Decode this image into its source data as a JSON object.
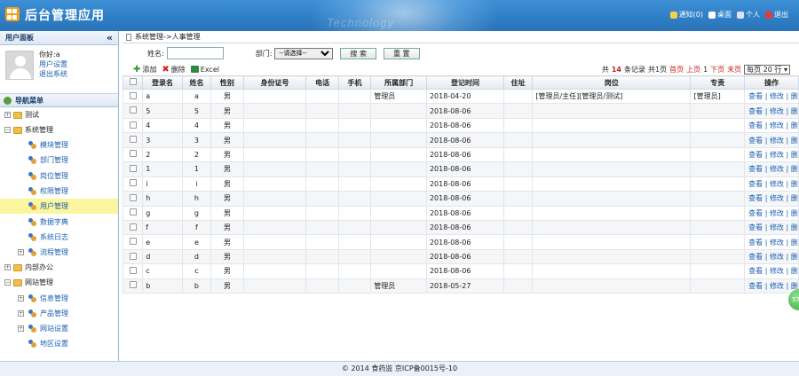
{
  "header": {
    "title": "后台管理应用",
    "watermark": "Technology",
    "links": [
      {
        "label": "通知(0)",
        "icon": "message-icon",
        "color": "#f6d04a"
      },
      {
        "label": "桌面",
        "icon": "home-icon",
        "color": "#ffffff"
      },
      {
        "label": "个人",
        "icon": "user-icon",
        "color": "#e0e0ff"
      },
      {
        "label": "退出",
        "icon": "power-icon",
        "color": "#e23b3b"
      }
    ]
  },
  "sidebar": {
    "panel_title": "用户面板",
    "collapse_glyph": "«",
    "greeting": "你好:a",
    "user_settings": "用户设置",
    "logout": "退出系统",
    "nav_title": "导航菜单",
    "tree": [
      {
        "label": "测试",
        "open": false,
        "children": []
      },
      {
        "label": "系统管理",
        "open": true,
        "children": [
          {
            "label": "模块管理"
          },
          {
            "label": "部门管理"
          },
          {
            "label": "岗位管理"
          },
          {
            "label": "权限管理"
          },
          {
            "label": "用户管理",
            "active": true
          },
          {
            "label": "数据字典"
          },
          {
            "label": "系统日志"
          },
          {
            "label": "流程管理",
            "expandable": true
          }
        ]
      },
      {
        "label": "内部办公",
        "open": false,
        "children": []
      },
      {
        "label": "网站管理",
        "open": true,
        "children": [
          {
            "label": "信息管理",
            "expandable": true
          },
          {
            "label": "产品管理",
            "expandable": true
          },
          {
            "label": "网站设置",
            "expandable": true
          },
          {
            "label": "地区设置"
          }
        ]
      }
    ]
  },
  "breadcrumb": "系统管理->人事管理",
  "filter": {
    "name_label": "姓名:",
    "name_value": "",
    "dept_label": "部门:",
    "dept_selected": "--请选择--",
    "search_button": "搜 索",
    "reset_button": "重 置"
  },
  "toolbar": {
    "add": "添加",
    "delete": "删除",
    "excel": "Excel"
  },
  "pager": {
    "total_prefix": "共",
    "total": "14",
    "total_suffix": "条记录",
    "pages": "共1页",
    "first": "首页",
    "prev": "上页",
    "current": "1",
    "next": "下页",
    "last": "末页",
    "per_page": "每页 20 行 ▾"
  },
  "table": {
    "columns": [
      "",
      "登录名",
      "姓名",
      "性别",
      "身份证号",
      "电话",
      "手机",
      "所属部门",
      "登记时间",
      "住址",
      "岗位",
      "专责",
      "操作"
    ],
    "rows": [
      [
        "a",
        "a",
        "男",
        "",
        "",
        "",
        "管理员",
        "2018-04-20",
        "",
        "[管理员/主任][管理员/测试]",
        "[管理员]"
      ],
      [
        "5",
        "5",
        "男",
        "",
        "",
        "",
        "",
        "2018-08-06",
        "",
        "",
        ""
      ],
      [
        "4",
        "4",
        "男",
        "",
        "",
        "",
        "",
        "2018-08-06",
        "",
        "",
        ""
      ],
      [
        "3",
        "3",
        "男",
        "",
        "",
        "",
        "",
        "2018-08-06",
        "",
        "",
        ""
      ],
      [
        "2",
        "2",
        "男",
        "",
        "",
        "",
        "",
        "2018-08-06",
        "",
        "",
        ""
      ],
      [
        "1",
        "1",
        "男",
        "",
        "",
        "",
        "",
        "2018-08-06",
        "",
        "",
        ""
      ],
      [
        "i",
        "i",
        "男",
        "",
        "",
        "",
        "",
        "2018-08-06",
        "",
        "",
        ""
      ],
      [
        "h",
        "h",
        "男",
        "",
        "",
        "",
        "",
        "2018-08-06",
        "",
        "",
        ""
      ],
      [
        "g",
        "g",
        "男",
        "",
        "",
        "",
        "",
        "2018-08-06",
        "",
        "",
        ""
      ],
      [
        "f",
        "f",
        "男",
        "",
        "",
        "",
        "",
        "2018-08-06",
        "",
        "",
        ""
      ],
      [
        "e",
        "e",
        "男",
        "",
        "",
        "",
        "",
        "2018-08-06",
        "",
        "",
        ""
      ],
      [
        "d",
        "d",
        "男",
        "",
        "",
        "",
        "",
        "2018-08-06",
        "",
        "",
        ""
      ],
      [
        "c",
        "c",
        "男",
        "",
        "",
        "",
        "",
        "2018-08-06",
        "",
        "",
        ""
      ],
      [
        "b",
        "b",
        "男",
        "",
        "",
        "",
        "管理员",
        "2018-05-27",
        "",
        "",
        ""
      ]
    ],
    "ops": [
      "查看",
      "修改",
      "删除"
    ]
  },
  "footer": "© 2014 食药监 京ICP备0015号-10",
  "float_ball": "57"
}
